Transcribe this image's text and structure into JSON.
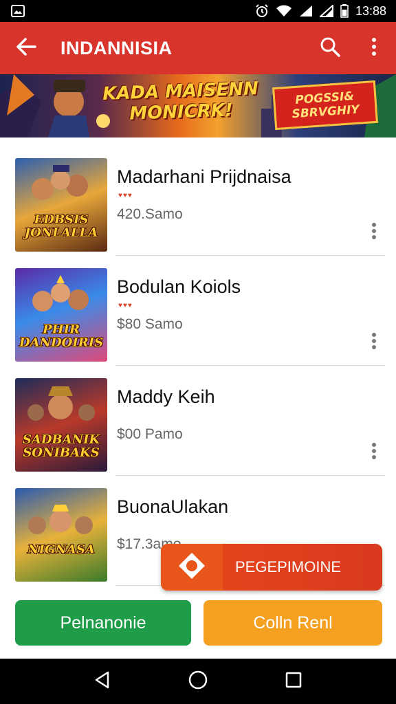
{
  "status_bar": {
    "time": "13:88",
    "icons": [
      "photo-icon",
      "alarm-icon",
      "wifi-icon",
      "signal-icon",
      "signal-icon",
      "battery-icon"
    ]
  },
  "app_bar": {
    "title": "INDANNISIA",
    "icons": [
      "back-arrow-icon",
      "search-icon",
      "more-vert-icon"
    ]
  },
  "banner": {
    "headline_line1": "KADA MAISENN",
    "headline_line2": "MONICRK!",
    "badge_line1": "POGSSI&",
    "badge_line2": "SBRVGHIY"
  },
  "items": [
    {
      "title": "Madarhani Prijdnaisa",
      "price": "420.Samo",
      "rating_dots": "♥♥♥",
      "thumb_text": "EDBSIS JONLALLA"
    },
    {
      "title": "Bodulan Koiols",
      "price": "$80 Samo",
      "rating_dots": "♥♥♥",
      "thumb_text": "PHIR DANDOIRIS"
    },
    {
      "title": "Maddy Keih",
      "price": "$00 Pamo",
      "rating_dots": "",
      "thumb_text": "SADBANIK SONIBAKS"
    },
    {
      "title": "BuonaUlakan",
      "price": "$17.3amo",
      "rating_dots": "",
      "thumb_text": "NIGNASA"
    }
  ],
  "promo": {
    "label": "PEGEPIMOINE"
  },
  "buttons": {
    "primary": "Pelnanonie",
    "secondary": "Colln Renl"
  },
  "colors": {
    "app_bar": "#d9342b",
    "primary_button": "#1e9c48",
    "secondary_button": "#f5a021",
    "promo": "#e8481c"
  },
  "nav": {
    "icons": [
      "back-triangle-icon",
      "home-circle-icon",
      "recents-square-icon"
    ]
  }
}
